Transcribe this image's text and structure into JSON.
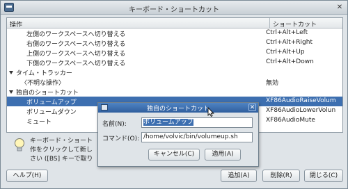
{
  "window": {
    "title": "キーボード・ショートカット",
    "close_glyph": "✕"
  },
  "list": {
    "columns": {
      "action": "操作",
      "shortcut": "ショートカット"
    },
    "rows": [
      {
        "action": "左側のワークスペースへ切り替える",
        "shortcut": "Ctrl+Alt+Left"
      },
      {
        "action": "右側のワークスペースへ切り替える",
        "shortcut": "Ctrl+Alt+Right"
      },
      {
        "action": "上側のワークスペースへ切り替える",
        "shortcut": "Ctrl+Alt+Up"
      },
      {
        "action": "下側のワークスペースへ切り替える",
        "shortcut": "Ctrl+Alt+Down"
      },
      {
        "action": "タイム・トラッカー",
        "shortcut": ""
      },
      {
        "action": "〈不明な操作〉",
        "shortcut": "無効"
      },
      {
        "action": "独自のショートカット",
        "shortcut": ""
      },
      {
        "action": "ボリュームアップ",
        "shortcut": "XF86AudioRaiseVolum"
      },
      {
        "action": "ボリュームダウン",
        "shortcut": "XF86AudioLowerVolun"
      },
      {
        "action": "ミュート",
        "shortcut": "XF86AudioMute"
      }
    ]
  },
  "info": {
    "line1": "キーボード・ショート",
    "line2": "作をクリックして新し",
    "line3": "さい ([BS] キーで取り"
  },
  "buttons": {
    "help": "ヘルプ(H)",
    "add": "追加(A)",
    "delete": "削除(R)",
    "close": "閉じる(C)"
  },
  "dialog": {
    "title": "独自のショートカット",
    "close_glyph": "✕",
    "name_label": "名前(N):",
    "name_value": "ボリュームアップ",
    "command_label": "コマンド(O):",
    "command_value": "/home/volvic/bin/volumeup.sh",
    "cancel": "キャンセル(C)",
    "apply": "適用(A)"
  },
  "colors": {
    "selection": "#3d6fb0",
    "dialog_titlebar": "#2f5e9d"
  }
}
